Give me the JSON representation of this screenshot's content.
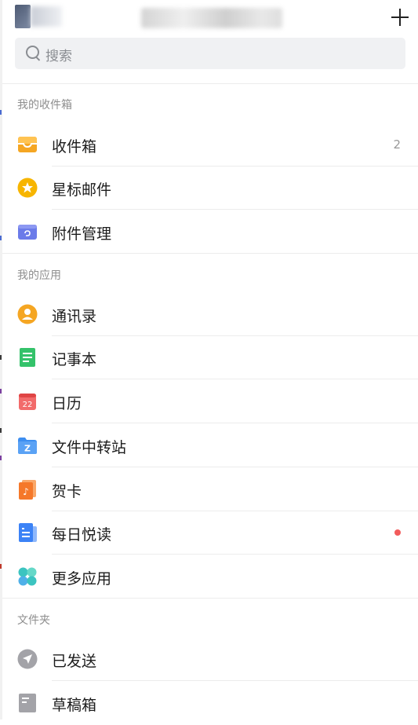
{
  "header": {
    "add_icon": "plus-icon"
  },
  "search": {
    "placeholder": "搜索",
    "icon": "search-icon"
  },
  "sections": {
    "my_inbox": "我的收件箱",
    "my_apps": "我的应用",
    "folders": "文件夹"
  },
  "inbox_items": [
    {
      "label": "收件箱",
      "icon": "inbox-tray-icon",
      "badge": "2",
      "color": "#f5a623"
    },
    {
      "label": "星标邮件",
      "icon": "star-icon",
      "color": "#f7b500"
    },
    {
      "label": "附件管理",
      "icon": "attachment-icon",
      "color": "#6b7be9"
    }
  ],
  "app_items": [
    {
      "label": "通讯录",
      "icon": "contacts-icon",
      "color": "#f5a623"
    },
    {
      "label": "记事本",
      "icon": "notepad-icon",
      "color": "#34c26a"
    },
    {
      "label": "日历",
      "icon": "calendar-icon",
      "icon_text": "22",
      "color": "#f26b6b"
    },
    {
      "label": "文件中转站",
      "icon": "file-transfer-icon",
      "icon_text": "Z",
      "color": "#3d8ef0"
    },
    {
      "label": "贺卡",
      "icon": "greeting-card-icon",
      "icon_text": "♪",
      "color": "#f5782a"
    },
    {
      "label": "每日悦读",
      "icon": "daily-reading-icon",
      "unread_dot": true,
      "color": "#3b82f6"
    },
    {
      "label": "更多应用",
      "icon": "more-apps-icon",
      "color": "#3cc4c0"
    }
  ],
  "folder_items": [
    {
      "label": "已发送",
      "icon": "sent-icon",
      "color": "#a3a3a8"
    },
    {
      "label": "草稿箱",
      "icon": "drafts-icon",
      "color": "#a3a3a8"
    }
  ]
}
